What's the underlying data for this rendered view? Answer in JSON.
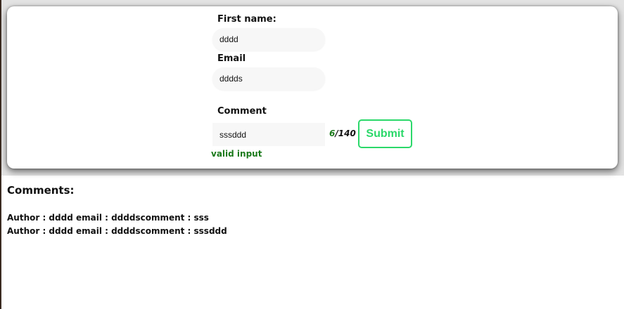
{
  "form": {
    "first_name_label": "First name:",
    "first_name_value": "dddd",
    "email_label": "Email",
    "email_value": "dddds",
    "comment_label": "Comment",
    "comment_value": "sssddd",
    "char_count": "6",
    "char_limit": "/140",
    "submit_label": "Submit",
    "validation_message": "valid input",
    "colors": {
      "accent": "#2bd86a",
      "valid": "#1b7a1b"
    }
  },
  "comments": {
    "title": "Comments:",
    "items": [
      "Author : dddd email : ddddscomment : sss",
      "Author : dddd email : ddddscomment : sssddd"
    ]
  }
}
